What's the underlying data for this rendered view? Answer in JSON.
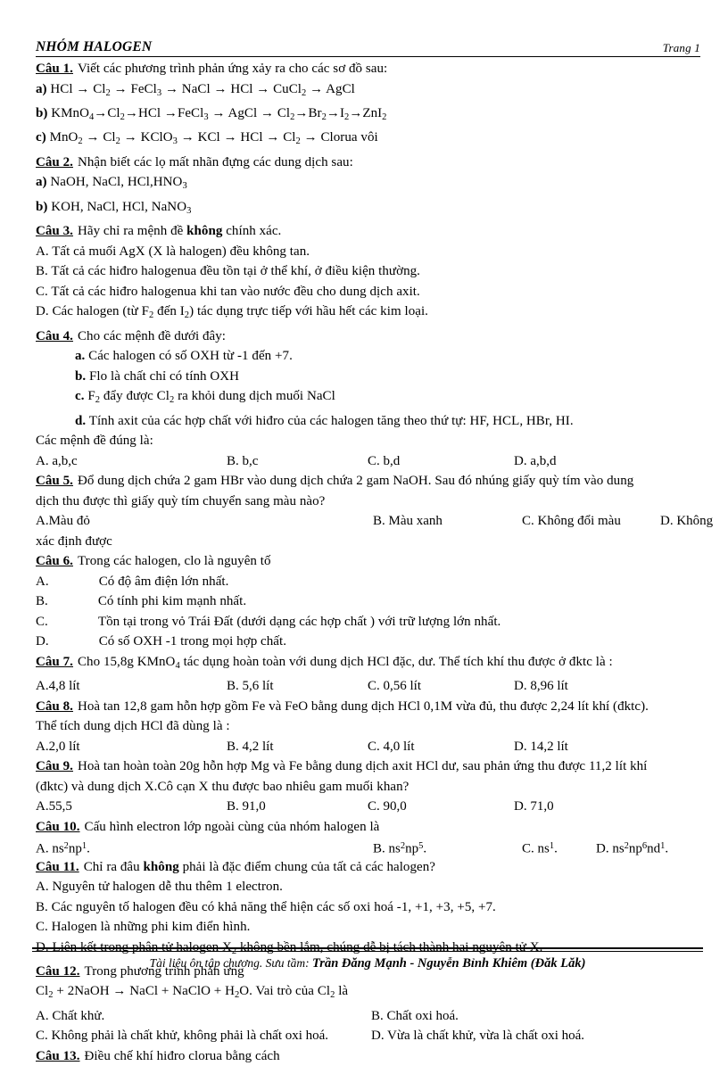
{
  "header": {
    "title": "NHÓM HALOGEN",
    "page_label": "Trang 1"
  },
  "questions": [
    {
      "id": "cau1",
      "label": "Câu 1.",
      "prompt": "Viết các phương trình phản ứng xảy ra cho các sơ đồ sau:",
      "items": [
        {
          "marker": "a)",
          "text": "HCl → Cl2 → FeCl3 → NaCl → HCl → CuCl2 → AgCl"
        },
        {
          "marker": "b)",
          "text": "KMnO4→Cl2→HCl →FeCl3 → AgCl → Cl2→Br2→I2→ZnI2"
        },
        {
          "marker": "c)",
          "text": "MnO2 → Cl2 → KClO3 → KCl → HCl → Cl2 → Clorua vôi"
        }
      ]
    },
    {
      "id": "cau2",
      "label": "Câu 2.",
      "prompt": "Nhận biết các lọ mất nhãn đựng các dung dịch sau:",
      "items": [
        {
          "marker": "a)",
          "text": "NaOH, NaCl, HCl,HNO3"
        },
        {
          "marker": "b)",
          "text": "KOH, NaCl, HCl, NaNO3"
        }
      ]
    },
    {
      "id": "cau3",
      "label": "Câu 3.",
      "prompt_pre": "Hãy chỉ ra mệnh đề ",
      "prompt_bold": "không",
      "prompt_post": " chính xác.",
      "choices": [
        "A.  Tất cả muối AgX (X là halogen)  đều không tan.",
        "B.   Tất cả các hiđro halogenua  đều tồn tại ở thể khí, ở điều kiện thường.",
        "C.  Tất cả các hiđro halogenua  khi tan vào nước đều cho dung dịch axit.",
        "D. Các halogen  (từ F2 đến I2) tác dụng trực tiếp với hầu hết các kim loại."
      ]
    },
    {
      "id": "cau4",
      "label": "Câu 4.",
      "prompt": "Cho các mệnh đề dưới đây:",
      "statements": [
        {
          "marker": "a.",
          "text": "Các halogen  có số OXH từ -1 đến +7."
        },
        {
          "marker": "b.",
          "text": "Flo là chất chỉ có tính  OXH"
        },
        {
          "marker": "c.",
          "text": "F2 đẩy được Cl2 ra khỏi dung dịch muối  NaCl"
        },
        {
          "marker": "d.",
          "text": "Tính axit của các hợp chất với hiđro của các halogen  tăng theo thứ tự: HF, HCL, HBr, HI."
        }
      ],
      "closing": "Các mệnh đề đúng là:",
      "options": [
        "A. a,b,c",
        "B. b,c",
        "C. b,d",
        "D. a,b,d"
      ]
    },
    {
      "id": "cau5",
      "label": "Câu 5.",
      "prompt_line1": "Đổ dung dịch chứa 2 gam HBr vào dung dịch chứa 2 gam NaOH. Sau đó nhúng  giấy  quỳ tím  vào dung",
      "prompt_line2": "dịch thu được thì giấy  quỳ tím  chuyển  sang màu nào?",
      "options": [
        "A.Màu đỏ",
        "B. Màu xanh",
        "C. Không đổi màu",
        "D. Không"
      ],
      "options_overflow": "xác định được"
    },
    {
      "id": "cau6",
      "label": "Câu 6.",
      "prompt": "Trong các halogen,  clo là nguyên  tố",
      "choices": [
        {
          "letter": "A.",
          "text": "Có độ âm điện lớn nhất."
        },
        {
          "letter": "B.",
          "text": "Có tính phi kim mạnh nhất."
        },
        {
          "letter": "C.",
          "text": "Tồn tại trong vỏ Trái Đất (dưới dạng các hợp chất ) với trữ lượng lớn nhất."
        },
        {
          "letter": "D.",
          "text": "Có số OXH -1 trong mọi hợp chất."
        }
      ]
    },
    {
      "id": "cau7",
      "label": "Câu 7.",
      "prompt": "Cho 15,8g KMnO4 tác dụng hoàn toàn với dung dịch HCl đặc, dư. Thể tích khí thu được ở đktc là :",
      "options": [
        "A.4,8 lít",
        "B. 5,6 lít",
        "C. 0,56 lít",
        "D. 8,96 lít"
      ]
    },
    {
      "id": "cau8",
      "label": "Câu 8.",
      "prompt_line1": "Hoà tan 12,8 gam hỗn hợp gồm Fe và FeO bằng dung dịch HCl 0,1M vừa đủ, thu được 2,24 lít khí (đktc).",
      "prompt_line2": "Thể tích dung dịch HCl đã dùng là :",
      "options": [
        "A.2,0 lít",
        "B. 4,2 lít",
        "C. 4,0 lít",
        "D. 14,2 lít"
      ]
    },
    {
      "id": "cau9",
      "label": "Câu 9.",
      "prompt_line1": "Hoà tan hoàn toàn 20g hỗn hợp Mg và Fe bằng dung dịch axit HCl dư, sau phản ứng thu được 11,2 lít khí",
      "prompt_line2": "(đktc) và dung dịch X.Cô cạn X thu được bao nhiêu gam muối khan?",
      "options": [
        "A.55,5",
        "B. 91,0",
        "C. 90,0",
        "D. 71,0"
      ]
    },
    {
      "id": "cau10",
      "label": "Câu 10.",
      "prompt": "Cấu hình electron lớp ngoài cùng của nhóm halogen là",
      "options": [
        "A. ns2np1.",
        "B. ns2np5.",
        "C. ns1.",
        "D. ns2np6nd1."
      ]
    },
    {
      "id": "cau11",
      "label": "Câu 11.",
      "prompt_pre": "Chỉ ra đâu ",
      "prompt_bold": "không",
      "prompt_post": " phải là đặc điểm chung của tất cả các halogen?",
      "choices": [
        "A. Nguyên tử halogen  dễ thu thêm 1 electron.",
        "B. Các nguyên tố halogen  đều có khả năng thể hiện các số oxi hoá -1, +1, +3, +5, +7.",
        "C. Halogen là những phi kim điển hình.",
        "D. Liên kết trong phân tử halogen  X2 không bền lắm, chúng dễ bị tách thành hai nguyên tử X."
      ]
    },
    {
      "id": "cau12",
      "label": "Câu 12.",
      "prompt": "Trong phương trình phản ứng",
      "equation": "Cl2 + 2NaOH → NaCl + NaClO + H2O. Vai trò của Cl2 là",
      "options_row1": [
        "A. Chất khử.",
        "B. Chất oxi hoá."
      ],
      "options_row2": [
        "C. Không phải là chất khử, không phải là chất oxi hoá.",
        "D. Vừa là chất khử, vừa là chất oxi hoá."
      ]
    },
    {
      "id": "cau13",
      "label": "Câu 13.",
      "prompt": "Điều chế khí hiđro clorua bằng cách"
    }
  ],
  "footer": {
    "prefix": "Tài liệu ôn tập chương. Sưu tầm:",
    "authors": "Trần Đăng Mạnh -  Nguyễn Bỉnh Khiêm (Đăk Lăk)"
  }
}
